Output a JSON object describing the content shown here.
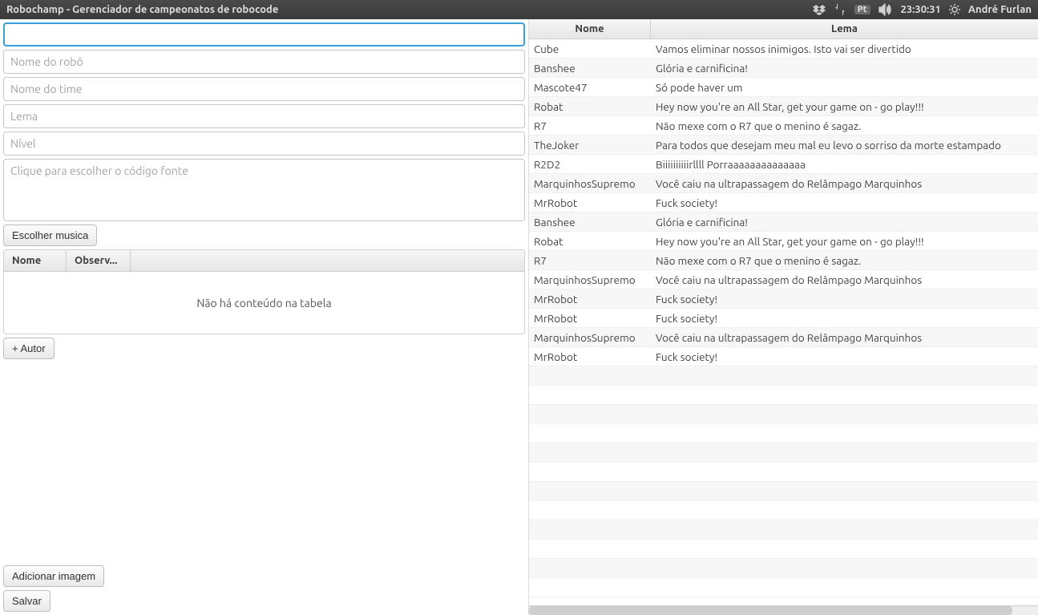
{
  "titlebar": {
    "title": "Robochamp - Gerenciador de campeonatos de robocode",
    "lang_badge": "Pt",
    "time": "23:30:31",
    "user": "André Furlan"
  },
  "form": {
    "field1_placeholder": "",
    "robot_name_placeholder": "Nome do robô",
    "team_name_placeholder": "Nome do time",
    "lema_placeholder": "Lema",
    "nivel_placeholder": "Nível",
    "source_placeholder": "Clique para escolher o código fonte",
    "choose_music_label": "Escolher musica",
    "mini_table_headers": {
      "nome": "Nome",
      "observ": "Observ..."
    },
    "mini_table_empty": "Não há conteúdo na tabela",
    "add_author_label": "+ Autor",
    "add_image_label": "Adicionar imagem",
    "save_label": "Salvar"
  },
  "robots_table": {
    "headers": {
      "nome": "Nome",
      "lema": "Lema"
    },
    "rows": [
      {
        "nome": "Cube",
        "lema": "Vamos eliminar nossos inimigos. Isto vai ser divertido"
      },
      {
        "nome": "Banshee",
        "lema": "Glória e carnificina!"
      },
      {
        "nome": "Mascote47",
        "lema": "Só pode haver um"
      },
      {
        "nome": "Robat",
        "lema": "Hey now you're an All Star, get your game on - go play!!!"
      },
      {
        "nome": "R7",
        "lema": "Não mexe com o R7 que o menino é sagaz."
      },
      {
        "nome": "TheJoker",
        "lema": "Para todos que desejam meu mal eu levo o sorriso da morte estampado"
      },
      {
        "nome": "R2D2",
        "lema": "Biiiiiiiiiirllll Porraaaaaaaaaaaaaa"
      },
      {
        "nome": "MarquinhosSupremo",
        "lema": "Você caiu na ultrapassagem do Relâmpago Marquinhos"
      },
      {
        "nome": "MrRobot",
        "lema": "Fuck society!"
      },
      {
        "nome": "Banshee",
        "lema": "Glória e carnificina!"
      },
      {
        "nome": "Robat",
        "lema": "Hey now you're an All Star, get your game on - go play!!!"
      },
      {
        "nome": "R7",
        "lema": "Não mexe com o R7 que o menino é sagaz."
      },
      {
        "nome": "MarquinhosSupremo",
        "lema": "Você caiu na ultrapassagem do Relâmpago Marquinhos"
      },
      {
        "nome": "MrRobot",
        "lema": "Fuck society!"
      },
      {
        "nome": "MrRobot",
        "lema": "Fuck society!"
      },
      {
        "nome": "MarquinhosSupremo",
        "lema": "Você caiu na ultrapassagem do Relâmpago Marquinhos"
      },
      {
        "nome": "MrRobot",
        "lema": "Fuck society!"
      },
      {
        "nome": "",
        "lema": ""
      },
      {
        "nome": "",
        "lema": ""
      },
      {
        "nome": "",
        "lema": ""
      },
      {
        "nome": "",
        "lema": ""
      },
      {
        "nome": "",
        "lema": ""
      },
      {
        "nome": "",
        "lema": ""
      },
      {
        "nome": "",
        "lema": ""
      },
      {
        "nome": "",
        "lema": ""
      },
      {
        "nome": "",
        "lema": ""
      },
      {
        "nome": "",
        "lema": ""
      },
      {
        "nome": "",
        "lema": ""
      },
      {
        "nome": "",
        "lema": ""
      }
    ]
  }
}
